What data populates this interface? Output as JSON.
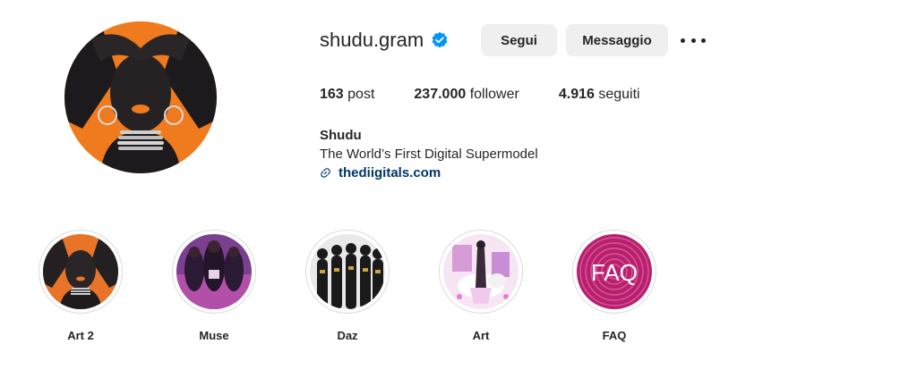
{
  "profile": {
    "username": "shudu.gram",
    "verified_icon": "verified-badge-icon",
    "accent_color": "#0095f6"
  },
  "actions": {
    "follow_label": "Segui",
    "message_label": "Messaggio",
    "more_icon": "more-options-icon"
  },
  "stats": {
    "posts_count": "163",
    "posts_label": "post",
    "followers_count": "237.000",
    "followers_label": "follower",
    "following_count": "4.916",
    "following_label": "seguiti"
  },
  "bio": {
    "name": "Shudu",
    "text": "The World’s First Digital Supermodel",
    "link_icon": "link-icon",
    "link": "thediigitals.com"
  },
  "highlights": [
    {
      "label": "Art 2"
    },
    {
      "label": "Muse"
    },
    {
      "label": "Daz"
    },
    {
      "label": "Art"
    },
    {
      "label": "FAQ",
      "cover_text": "FAQ"
    }
  ]
}
